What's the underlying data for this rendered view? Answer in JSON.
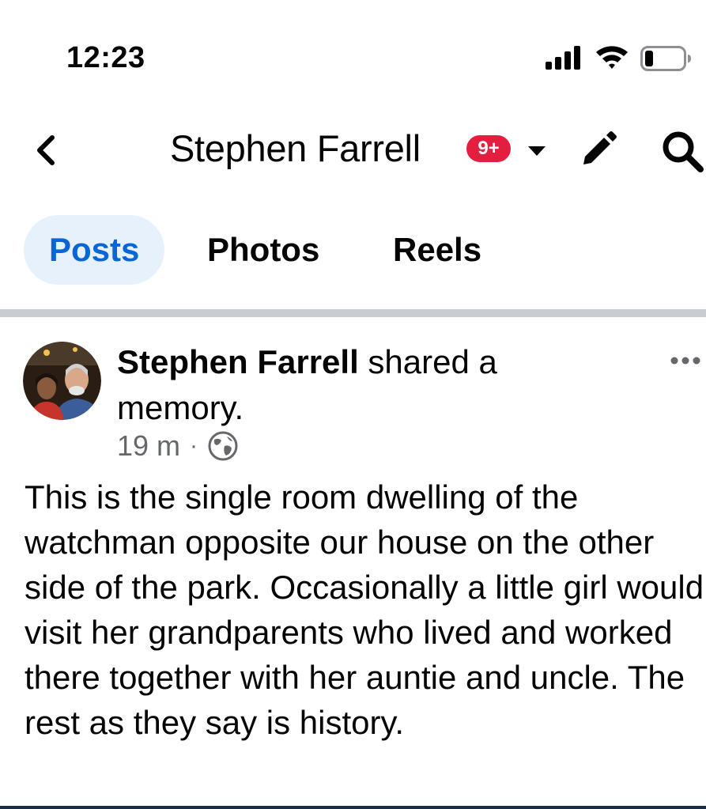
{
  "status_bar": {
    "time": "12:23",
    "icons": [
      "cellular-signal-icon",
      "wifi-icon",
      "battery-icon"
    ]
  },
  "header": {
    "title": "Stephen Farrell",
    "badge": "9+",
    "icons": [
      "back-chevron-icon",
      "caret-down-icon",
      "pencil-icon",
      "search-icon"
    ]
  },
  "tabs": [
    {
      "label": "Posts",
      "active": true
    },
    {
      "label": "Photos",
      "active": false
    },
    {
      "label": "Reels",
      "active": false
    }
  ],
  "post": {
    "author": "Stephen Farrell",
    "action": " shared a memory.",
    "time": "19 m",
    "separator": "·",
    "privacy_icon": "globe-icon",
    "body": "This is the single room dwelling of the watchman opposite our house on the other side of the park. Occasionally a little girl would visit her grandparents who lived and worked there together with her auntie and uncle. The rest as they say is history."
  },
  "colors": {
    "accent_blue": "#0866d6",
    "active_tab_bg": "#e7f1fc",
    "badge_red": "#e41e3f",
    "secondary_text": "#65676b",
    "divider": "#c9ccd1"
  }
}
